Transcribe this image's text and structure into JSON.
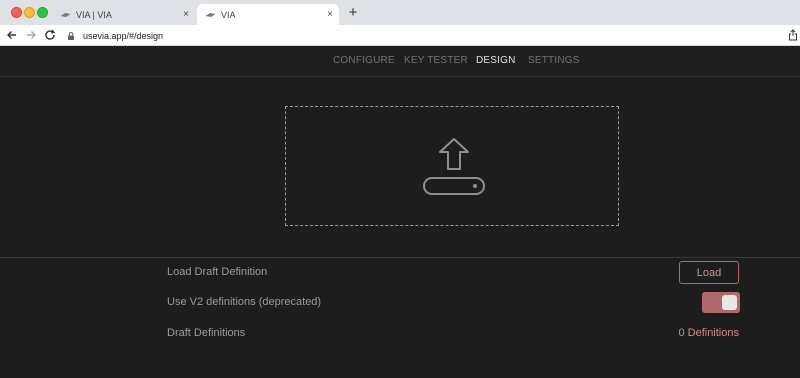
{
  "browser": {
    "tabs": [
      {
        "title": "VIA | VIA",
        "close": "×",
        "active": false
      },
      {
        "title": "VIA",
        "close": "×",
        "active": true
      }
    ],
    "new_tab": "+",
    "url": "usevia.app/#/design"
  },
  "nav": {
    "items": [
      "CONFIGURE",
      "KEY TESTER",
      "DESIGN",
      "SETTINGS"
    ],
    "active": "DESIGN"
  },
  "dropzone": {
    "icon": "upload-icon"
  },
  "settings": {
    "load_draft": {
      "label": "Load Draft Definition",
      "button": "Load"
    },
    "use_v2": {
      "label": "Use V2 definitions (deprecated)",
      "enabled": true
    },
    "draft_definitions": {
      "label": "Draft Definitions",
      "value": "0 Definitions"
    }
  },
  "colors": {
    "accent": "#b06a6a",
    "accent_text": "#d28a8a",
    "background": "#1d1d1d"
  }
}
